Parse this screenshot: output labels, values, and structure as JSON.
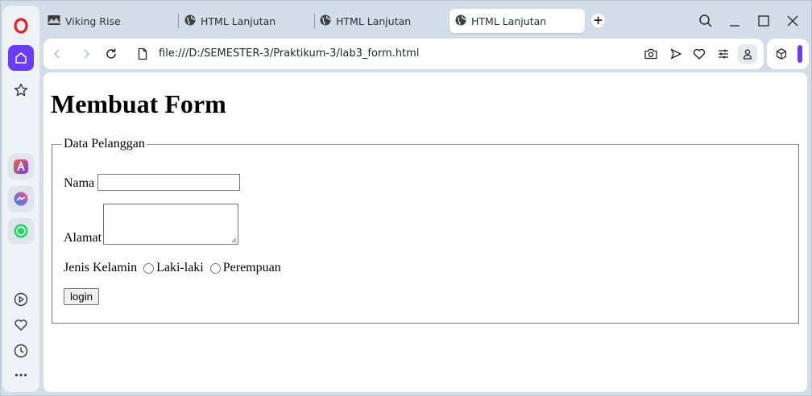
{
  "browser": {
    "tabs": [
      {
        "label": "Viking Rise",
        "active": false,
        "icon": "game-favicon"
      },
      {
        "label": "HTML Lanjutan",
        "active": false,
        "icon": "globe-icon"
      },
      {
        "label": "HTML Lanjutan",
        "active": false,
        "icon": "globe-icon"
      },
      {
        "label": "HTML Lanjutan",
        "active": true,
        "icon": "globe-icon"
      }
    ],
    "new_tab_symbol": "+",
    "address": "file:///D:/SEMESTER-3/Praktikum-3/lab3_form.html",
    "accent_color": "#6a3cf5"
  },
  "page": {
    "title": "Membuat Form",
    "form": {
      "legend": "Data Pelanggan",
      "name_label": "Nama",
      "name_value": "",
      "address_label": "Alamat",
      "address_value": "",
      "gender_label": "Jenis Kelamin",
      "gender_options": [
        "Laki-laki",
        "Perempuan"
      ],
      "submit_label": "login"
    }
  }
}
